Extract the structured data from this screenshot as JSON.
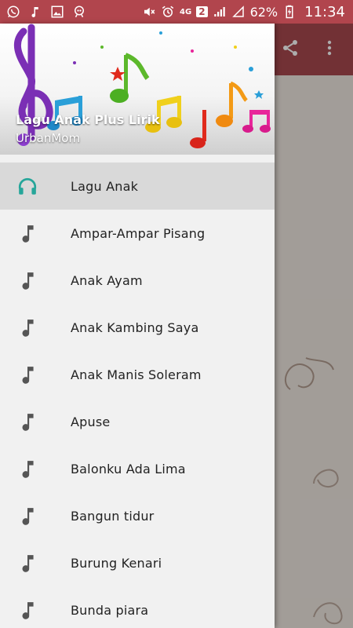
{
  "status_bar": {
    "left_icons": [
      "whatsapp-icon",
      "music-note-icon",
      "image-icon",
      "game-icon"
    ],
    "network": "4G",
    "sim_slot": "2",
    "battery_percent": "62%",
    "time": "11:34"
  },
  "toolbar": {
    "actions": [
      "share-icon",
      "more-vert-icon"
    ]
  },
  "drawer": {
    "header": {
      "title": "Lagu Anak Plus Lirik",
      "subtitle": "UrbanMom"
    },
    "items": [
      {
        "label": "Lagu Anak",
        "icon": "headphones-icon",
        "active": true
      },
      {
        "label": "Ampar-Ampar Pisang",
        "icon": "music-note-icon"
      },
      {
        "label": "Anak Ayam",
        "icon": "music-note-icon"
      },
      {
        "label": "Anak Kambing Saya",
        "icon": "music-note-icon"
      },
      {
        "label": "Anak Manis Soleram",
        "icon": "music-note-icon"
      },
      {
        "label": "Apuse",
        "icon": "music-note-icon"
      },
      {
        "label": "Balonku Ada Lima",
        "icon": "music-note-icon"
      },
      {
        "label": "Bangun tidur",
        "icon": "music-note-icon"
      },
      {
        "label": "Burung Kenari",
        "icon": "music-note-icon"
      },
      {
        "label": "Bunda piara",
        "icon": "music-note-icon"
      }
    ]
  },
  "colors": {
    "status_bar": "#b1454d",
    "toolbar": "#a8494f",
    "active_icon": "#26a69a",
    "note_icon": "#555555"
  }
}
